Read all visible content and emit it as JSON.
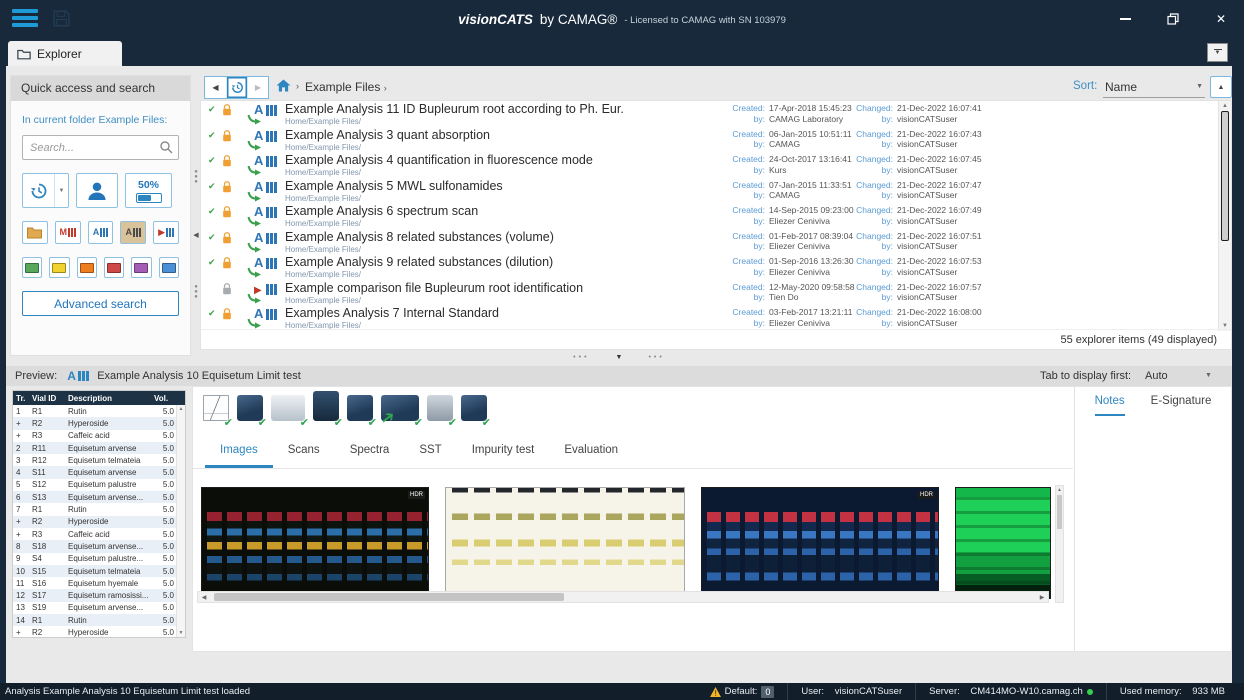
{
  "titlebar": {
    "brand": "visionCATS",
    "brand_suffix": "by CAMAG®",
    "license": "-  Licensed to CAMAG with SN 103979"
  },
  "tabbar": {
    "explorer_tab": "Explorer"
  },
  "quick_access": {
    "header": "Quick access and search",
    "context_line": "In current folder Example Files:",
    "search_placeholder": "Search...",
    "zoom_value": "50%",
    "advanced_button": "Advanced search",
    "type_filters": [
      {
        "name": "folder-filter",
        "glyph": "folder"
      },
      {
        "name": "method-filter",
        "glyph": "M",
        "color": "#c0392b",
        "bars": "#c0392b"
      },
      {
        "name": "analysis-filter",
        "glyph": "A",
        "color": "#2e75b6",
        "bars": "#2e75b6"
      },
      {
        "name": "analysis-template-filter",
        "glyph": "A",
        "color": "#4a4a4a",
        "bars": "#4a4a4a",
        "bg": "#d9c39a"
      },
      {
        "name": "comparison-filter",
        "glyph": "▶",
        "color": "#c0392b",
        "bars": "#2e75b6"
      }
    ],
    "color_filters": [
      "#57a75c",
      "#f2d22e",
      "#ee7d1e",
      "#cf4a47",
      "#a45cb4",
      "#4b8fd4"
    ]
  },
  "toolbar": {
    "breadcrumb": "Example Files",
    "caret": "›",
    "sort_label": "Sort:",
    "sort_value": "Name"
  },
  "explorer": {
    "labels": {
      "created": "Created:",
      "changed": "Changed:",
      "by": "by:"
    },
    "items": [
      {
        "checked": true,
        "lock": "orange",
        "icon": "analysis",
        "title": "Example Analysis 11 ID Bupleurum root according to Ph. Eur.",
        "path": "Home/Example Files/",
        "created_date": "17-Apr-2018 15:45:23",
        "created_by": "CAMAG Laboratory",
        "changed_date": "21-Dec-2022 16:07:41",
        "changed_by": "visionCATSuser"
      },
      {
        "checked": true,
        "lock": "orange",
        "icon": "analysis",
        "title": "Example Analysis 3 quant absorption",
        "path": "Home/Example Files/",
        "created_date": "06-Jan-2015 10:51:11",
        "created_by": "CAMAG",
        "changed_date": "21-Dec-2022 16:07:43",
        "changed_by": "visionCATSuser"
      },
      {
        "checked": true,
        "lock": "orange",
        "icon": "analysis",
        "title": "Example Analysis 4 quantification in fluorescence mode",
        "path": "Home/Example Files/",
        "created_date": "24-Oct-2017 13:16:41",
        "created_by": "Kurs",
        "changed_date": "21-Dec-2022 16:07:45",
        "changed_by": "visionCATSuser"
      },
      {
        "checked": true,
        "lock": "orange",
        "icon": "analysis",
        "title": "Example Analysis 5 MWL sulfonamides",
        "path": "Home/Example Files/",
        "created_date": "07-Jan-2015 11:33:51",
        "created_by": "CAMAG",
        "changed_date": "21-Dec-2022 16:07:47",
        "changed_by": "visionCATSuser"
      },
      {
        "checked": true,
        "lock": "orange",
        "icon": "analysis",
        "title": "Example Analysis 6 spectrum scan",
        "path": "Home/Example Files/",
        "created_date": "14-Sep-2015 09:23:00",
        "created_by": "Eliezer Ceniviva",
        "changed_date": "21-Dec-2022 16:07:49",
        "changed_by": "visionCATSuser"
      },
      {
        "checked": true,
        "lock": "orange",
        "icon": "analysis",
        "title": "Example Analysis 8 related substances (volume)",
        "path": "Home/Example Files/",
        "created_date": "01-Feb-2017 08:39:04",
        "created_by": "Eliezer Ceniviva",
        "changed_date": "21-Dec-2022 16:07:51",
        "changed_by": "visionCATSuser"
      },
      {
        "checked": true,
        "lock": "orange",
        "icon": "analysis",
        "title": "Example Analysis 9 related substances (dilution)",
        "path": "Home/Example Files/",
        "created_date": "01-Sep-2016 13:26:30",
        "created_by": "Eliezer Ceniviva",
        "changed_date": "21-Dec-2022 16:07:53",
        "changed_by": "visionCATSuser"
      },
      {
        "checked": false,
        "lock": "gray",
        "icon": "comparison",
        "title": "Example comparison file Bupleurum root identification",
        "path": "Home/Example Files/",
        "created_date": "12-May-2020 09:58:58",
        "created_by": "Tien Do",
        "changed_date": "21-Dec-2022 16:07:57",
        "changed_by": "visionCATSuser"
      },
      {
        "checked": true,
        "lock": "orange",
        "icon": "analysis",
        "title": "Examples Analysis 7 Internal Standard",
        "path": "Home/Example Files/",
        "created_date": "03-Feb-2017 13:21:11",
        "created_by": "Eliezer Ceniviva",
        "changed_date": "21-Dec-2022 16:08:00",
        "changed_by": "visionCATSuser"
      }
    ],
    "footer": "55 explorer items (49 displayed)"
  },
  "preview": {
    "label": "Preview:",
    "title": "Example Analysis 10 Equisetum Limit test",
    "tab_first_label": "Tab to display first:",
    "tab_first_value": "Auto",
    "instrument_steps": [
      {
        "variant": "v-plate",
        "checked": true
      },
      {
        "variant": "v-dark",
        "checked": true
      },
      {
        "variant": "v-wide",
        "checked": true
      },
      {
        "variant": "v-tall",
        "checked": true
      },
      {
        "variant": "v-dark",
        "checked": true
      },
      {
        "variant": "v-big",
        "checked": true,
        "arrow": true
      },
      {
        "variant": "v-light",
        "checked": true
      },
      {
        "variant": "v-dark",
        "checked": true
      }
    ],
    "content_tabs": [
      "Images",
      "Scans",
      "Spectra",
      "SST",
      "Impurity test",
      "Evaluation"
    ],
    "active_tab": "Images",
    "side_tabs": [
      "Notes",
      "E-Signature"
    ],
    "active_side_tab": "Notes",
    "thumbnails": [
      {
        "name": "plate-image-1",
        "variant": "dark",
        "badge": "HDR"
      },
      {
        "name": "plate-image-2",
        "variant": "light",
        "badge": ""
      },
      {
        "name": "plate-image-3",
        "variant": "blue",
        "badge": "HDR"
      },
      {
        "name": "plate-image-4",
        "variant": "green",
        "badge": ""
      }
    ],
    "vial_table": {
      "headers": [
        "Tr.",
        "Vial ID",
        "Description",
        "Vol."
      ],
      "rows": [
        [
          "1",
          "R1",
          "Rutin",
          "5.0"
        ],
        [
          "+",
          "R2",
          "Hyperoside",
          "5.0"
        ],
        [
          "+",
          "R3",
          "Caffeic acid",
          "5.0"
        ],
        [
          "2",
          "R11",
          "Equisetum arvense",
          "5.0"
        ],
        [
          "3",
          "R12",
          "Equisetum telmateia",
          "5.0"
        ],
        [
          "4",
          "S11",
          "Equisetum arvense",
          "5.0"
        ],
        [
          "5",
          "S12",
          "Equisetum palustre",
          "5.0"
        ],
        [
          "6",
          "S13",
          "Equisetum arvense...",
          "5.0"
        ],
        [
          "7",
          "R1",
          "Rutin",
          "5.0"
        ],
        [
          "+",
          "R2",
          "Hyperoside",
          "5.0"
        ],
        [
          "+",
          "R3",
          "Caffeic acid",
          "5.0"
        ],
        [
          "8",
          "S18",
          "Equisetum arvense...",
          "5.0"
        ],
        [
          "9",
          "S4",
          "Equisetum palustre...",
          "5.0"
        ],
        [
          "10",
          "S15",
          "Equisetum telmateia",
          "5.0"
        ],
        [
          "11",
          "S16",
          "Equisetum hyemale",
          "5.0"
        ],
        [
          "12",
          "S17",
          "Equisetum ramosissi...",
          "5.0"
        ],
        [
          "13",
          "S19",
          "Equisetum arvense...",
          "5.0"
        ],
        [
          "14",
          "R1",
          "Rutin",
          "5.0"
        ],
        [
          "+",
          "R2",
          "Hyperoside",
          "5.0"
        ]
      ]
    }
  },
  "statusbar": {
    "message": "Analysis Example Analysis 10 Equisetum Limit test loaded",
    "default_label": "Default:",
    "default_count": "0",
    "user_label": "User:",
    "user": "visionCATSuser",
    "server_label": "Server:",
    "server": "CM414MO-W10.camag.ch",
    "memory_label": "Used memory:",
    "memory": "933 MB"
  }
}
